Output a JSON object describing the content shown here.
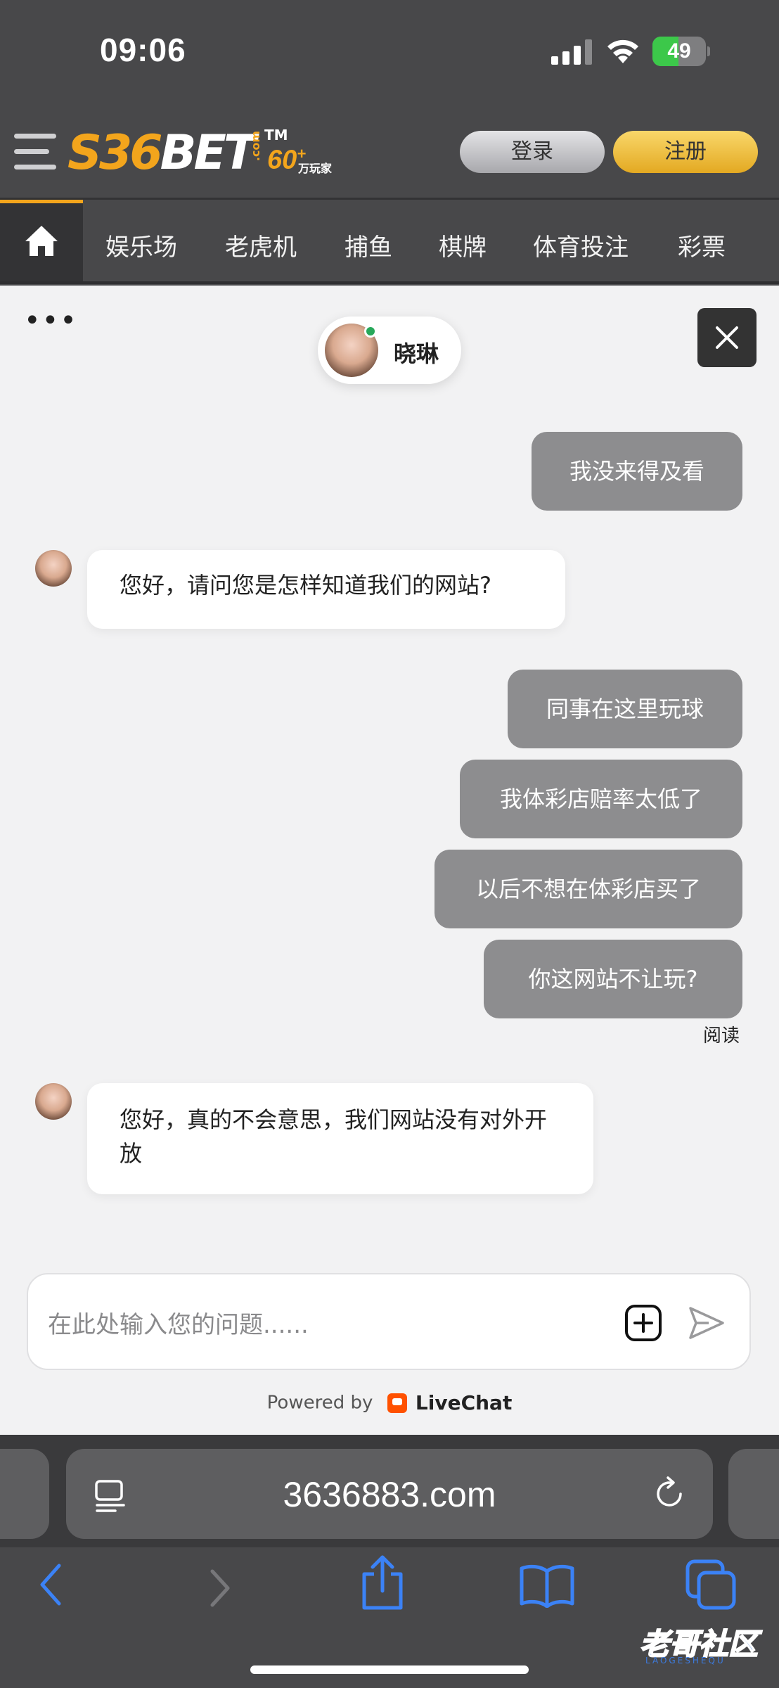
{
  "status_bar": {
    "time": "09:06",
    "battery": "49",
    "battery_level": 0.49
  },
  "header": {
    "logo_main": "S36",
    "logo_bet": "BET",
    "logo_com": ".com",
    "logo_tm": "TM",
    "logo_60": "60",
    "logo_plus": "+",
    "logo_wan": "万玩家",
    "login_label": "登录",
    "register_label": "注册"
  },
  "nav": {
    "items": [
      {
        "label": "娱乐场"
      },
      {
        "label": "老虎机"
      },
      {
        "label": "捕鱼"
      },
      {
        "label": "棋牌"
      },
      {
        "label": "体育投注"
      },
      {
        "label": "彩票"
      }
    ]
  },
  "chat": {
    "menu_dots": "•••",
    "agent_name": "晓琳",
    "messages": [
      {
        "from": "user",
        "text": "我没来得及看"
      },
      {
        "from": "agent",
        "text": "您好，请问您是怎样知道我们的网站?"
      },
      {
        "from": "user",
        "text": "同事在这里玩球"
      },
      {
        "from": "user",
        "text": "我体彩店赔率太低了"
      },
      {
        "from": "user",
        "text": "以后不想在体彩店买了"
      },
      {
        "from": "user",
        "text": "你这网站不让玩?"
      },
      {
        "from": "agent",
        "text": "您好，真的不会意思，我们网站没有对外开放"
      }
    ],
    "read_label": "阅读",
    "composer_placeholder": "在此处输入您的问题......",
    "powered_by": "Powered by",
    "livechat_name": "LiveChat"
  },
  "safari": {
    "url": "3636883.com"
  },
  "watermark": {
    "text": "老哥社区",
    "sub": "LAOGESHEQU"
  },
  "colors": {
    "brand_orange": "#f3a51c",
    "register_gold": "#e3a922",
    "user_bubble": "#8d8d8f",
    "online_green": "#27a85a",
    "ios_blue": "#3b82f6"
  },
  "icons": [
    "hamburger-icon",
    "home-icon",
    "close-icon",
    "attach-icon",
    "send-icon",
    "reader-icon",
    "reload-icon",
    "back-icon",
    "forward-icon",
    "share-icon",
    "bookmarks-icon",
    "tabs-icon"
  ]
}
